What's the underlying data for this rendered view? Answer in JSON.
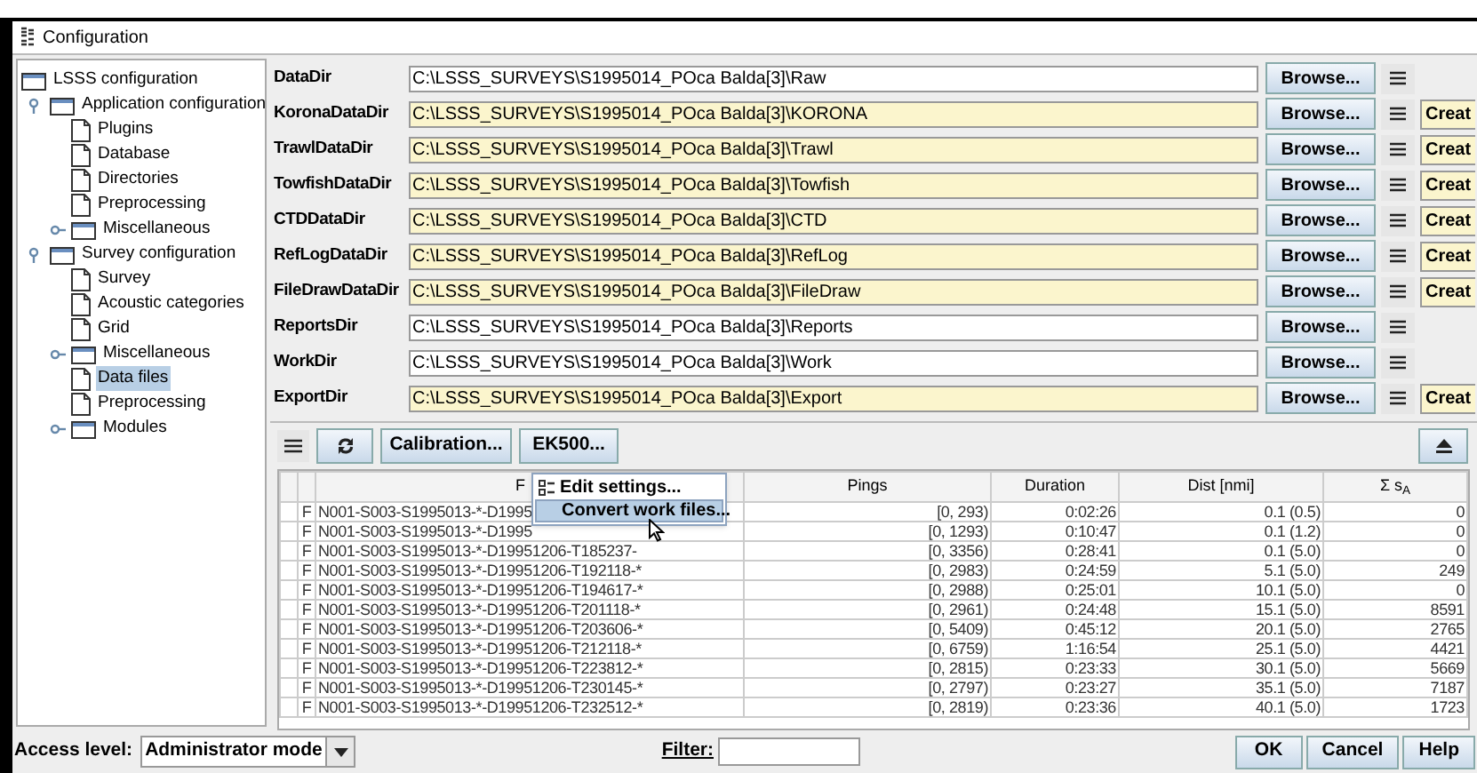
{
  "window": {
    "title": "Configuration"
  },
  "tree": [
    {
      "label": "LSSS configuration",
      "kind": "folder",
      "selected": false,
      "children": [
        {
          "label": "Application configuration",
          "kind": "folder",
          "expanded": true,
          "selected": false,
          "children": [
            {
              "label": "Plugins",
              "kind": "page",
              "selected": false
            },
            {
              "label": "Database",
              "kind": "page",
              "selected": false
            },
            {
              "label": "Directories",
              "kind": "page",
              "selected": false
            },
            {
              "label": "Preprocessing",
              "kind": "page",
              "selected": false
            },
            {
              "label": "Miscellaneous",
              "kind": "folder",
              "expanded": false,
              "selected": false
            }
          ]
        },
        {
          "label": "Survey configuration",
          "kind": "folder",
          "expanded": true,
          "selected": false,
          "children": [
            {
              "label": "Survey",
              "kind": "page",
              "selected": false
            },
            {
              "label": "Acoustic categories",
              "kind": "page",
              "selected": false
            },
            {
              "label": "Grid",
              "kind": "page",
              "selected": false
            },
            {
              "label": "Miscellaneous",
              "kind": "folder",
              "expanded": false,
              "selected": false
            },
            {
              "label": "Data files",
              "kind": "page",
              "selected": true
            },
            {
              "label": "Preprocessing",
              "kind": "page",
              "selected": false
            },
            {
              "label": "Modules",
              "kind": "folder",
              "expanded": false,
              "selected": false
            }
          ]
        }
      ]
    }
  ],
  "directories": [
    {
      "label": "DataDir",
      "path": "C:\\LSSS_SURVEYS\\S1995014_POca Balda[3]\\Raw",
      "highlighted": false,
      "browse": "Browse..."
    },
    {
      "label": "KoronaDataDir",
      "path": "C:\\LSSS_SURVEYS\\S1995014_POca Balda[3]\\KORONA",
      "highlighted": true,
      "browse": "Browse...",
      "create": "Creat"
    },
    {
      "label": "TrawlDataDir",
      "path": "C:\\LSSS_SURVEYS\\S1995014_POca Balda[3]\\Trawl",
      "highlighted": true,
      "browse": "Browse...",
      "create": "Creat"
    },
    {
      "label": "TowfishDataDir",
      "path": "C:\\LSSS_SURVEYS\\S1995014_POca Balda[3]\\Towfish",
      "highlighted": true,
      "browse": "Browse...",
      "create": "Creat"
    },
    {
      "label": "CTDDataDir",
      "path": "C:\\LSSS_SURVEYS\\S1995014_POca Balda[3]\\CTD",
      "highlighted": true,
      "browse": "Browse...",
      "create": "Creat"
    },
    {
      "label": "RefLogDataDir",
      "path": "C:\\LSSS_SURVEYS\\S1995014_POca Balda[3]\\RefLog",
      "highlighted": true,
      "browse": "Browse...",
      "create": "Creat"
    },
    {
      "label": "FileDrawDataDir",
      "path": "C:\\LSSS_SURVEYS\\S1995014_POca Balda[3]\\FileDraw",
      "highlighted": true,
      "browse": "Browse...",
      "create": "Creat"
    },
    {
      "label": "ReportsDir",
      "path": "C:\\LSSS_SURVEYS\\S1995014_POca Balda[3]\\Reports",
      "highlighted": false,
      "browse": "Browse..."
    },
    {
      "label": "WorkDir",
      "path": "C:\\LSSS_SURVEYS\\S1995014_POca Balda[3]\\Work",
      "highlighted": false,
      "browse": "Browse..."
    },
    {
      "label": "ExportDir",
      "path": "C:\\LSSS_SURVEYS\\S1995014_POca Balda[3]\\Export",
      "highlighted": true,
      "browse": "Browse...",
      "create": "Creat"
    }
  ],
  "toolbar": {
    "buttons": [
      "Calibration...",
      "EK500..."
    ]
  },
  "table": {
    "columns": [
      "F",
      "Pings",
      "Duration",
      "Dist [nmi]",
      "Σ s$_{A}$"
    ],
    "rows": [
      {
        "flag": "F",
        "file": "N001-S003-S1995013-*-D1995",
        "pings": "[0, 293)",
        "duration": "0:02:26",
        "dist": "0.1 (0.5)",
        "sa": "0"
      },
      {
        "flag": "F",
        "file": "N001-S003-S1995013-*-D1995",
        "pings": "[0, 1293)",
        "duration": "0:10:47",
        "dist": "0.1 (1.2)",
        "sa": "0"
      },
      {
        "flag": "F",
        "file": "N001-S003-S1995013-*-D19951206-T185237-",
        "pings": "[0, 3356)",
        "duration": "0:28:41",
        "dist": "0.1 (5.0)",
        "sa": "0"
      },
      {
        "flag": "F",
        "file": "N001-S003-S1995013-*-D19951206-T192118-*",
        "pings": "[0, 2983)",
        "duration": "0:24:59",
        "dist": "5.1 (5.0)",
        "sa": "249"
      },
      {
        "flag": "F",
        "file": "N001-S003-S1995013-*-D19951206-T194617-*",
        "pings": "[0, 2988)",
        "duration": "0:25:01",
        "dist": "10.1 (5.0)",
        "sa": "0"
      },
      {
        "flag": "F",
        "file": "N001-S003-S1995013-*-D19951206-T201118-*",
        "pings": "[0, 2961)",
        "duration": "0:24:48",
        "dist": "15.1 (5.0)",
        "sa": "8591"
      },
      {
        "flag": "F",
        "file": "N001-S003-S1995013-*-D19951206-T203606-*",
        "pings": "[0, 5409)",
        "duration": "0:45:12",
        "dist": "20.1 (5.0)",
        "sa": "2765"
      },
      {
        "flag": "F",
        "file": "N001-S003-S1995013-*-D19951206-T212118-*",
        "pings": "[0, 6759)",
        "duration": "1:16:54",
        "dist": "25.1 (5.0)",
        "sa": "4421"
      },
      {
        "flag": "F",
        "file": "N001-S003-S1995013-*-D19951206-T223812-*",
        "pings": "[0, 2815)",
        "duration": "0:23:33",
        "dist": "30.1 (5.0)",
        "sa": "5669"
      },
      {
        "flag": "F",
        "file": "N001-S003-S1995013-*-D19951206-T230145-*",
        "pings": "[0, 2797)",
        "duration": "0:23:27",
        "dist": "35.1 (5.0)",
        "sa": "7187"
      },
      {
        "flag": "F",
        "file": "N001-S003-S1995013-*-D19951206-T232512-*",
        "pings": "[0, 2819)",
        "duration": "0:23:36",
        "dist": "40.1 (5.0)",
        "sa": "1723"
      }
    ]
  },
  "context_menu": {
    "items": [
      {
        "label": "Edit settings...",
        "kind": "settings",
        "selected": false
      },
      {
        "label": "Convert work files...",
        "kind": "plain",
        "selected": true
      }
    ]
  },
  "bottom_bar": {
    "access_label": "Access level:",
    "access_value": "Administrator mode",
    "filter_label": "Filter:",
    "buttons": [
      "OK",
      "Cancel",
      "Help"
    ]
  }
}
